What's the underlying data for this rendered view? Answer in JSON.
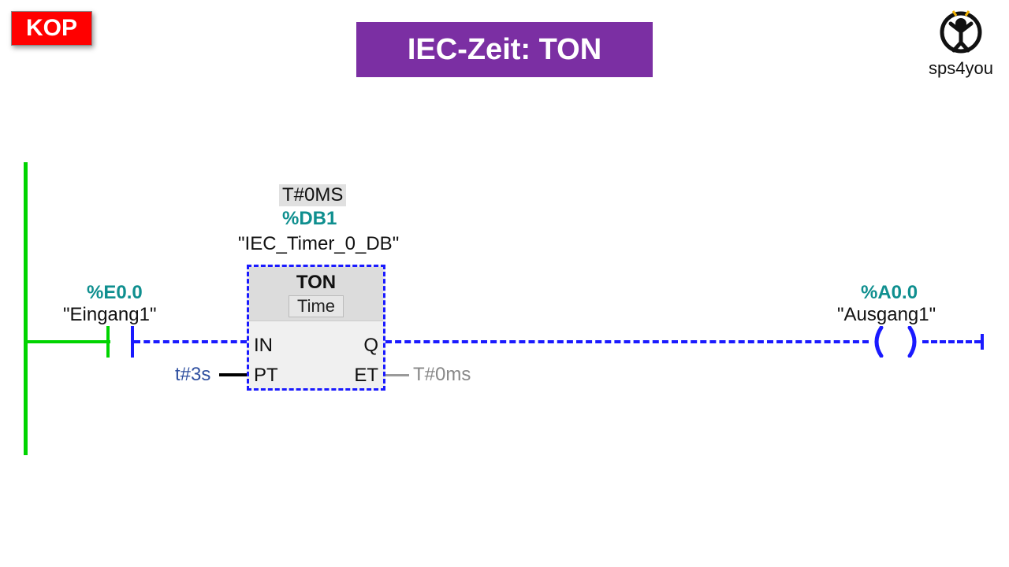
{
  "header": {
    "kop_label": "KOP",
    "title": "IEC-Zeit: TON",
    "logo_text": "sps4you"
  },
  "diagram": {
    "rail": {},
    "contact": {
      "address": "%E0.0",
      "name": "\"Eingang1\""
    },
    "timer": {
      "elapsed_display": "T#0MS",
      "db_address": "%DB1",
      "db_name": "\"IEC_Timer_0_DB\"",
      "type": "TON",
      "datatype": "Time",
      "pins": {
        "IN": "IN",
        "Q": "Q",
        "PT": "PT",
        "ET": "ET"
      },
      "pt_value": "t#3s",
      "et_value": "T#0ms"
    },
    "coil": {
      "address": "%A0.0",
      "name": "\"Ausgang1\""
    }
  }
}
